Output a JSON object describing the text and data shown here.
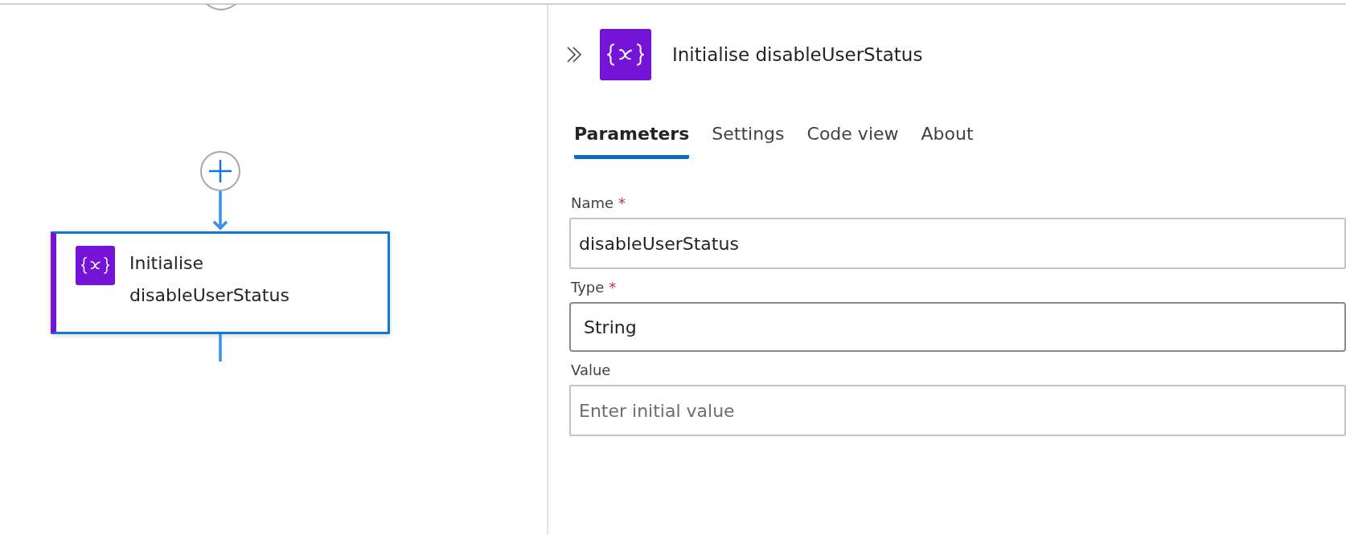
{
  "canvas": {
    "node": {
      "title": "Initialise disableUserStatus",
      "selected": true
    }
  },
  "panel": {
    "title": "Initialise disableUserStatus",
    "tabs": [
      {
        "label": "Parameters",
        "selected": true
      },
      {
        "label": "Settings",
        "selected": false
      },
      {
        "label": "Code view",
        "selected": false
      },
      {
        "label": "About",
        "selected": false
      }
    ],
    "fields": [
      {
        "kind": "text",
        "label": "Name",
        "required_mark": "*",
        "value": "disableUserStatus"
      },
      {
        "kind": "select",
        "label": "Type",
        "required_mark": "*",
        "value": "String"
      },
      {
        "kind": "text",
        "label": "Value",
        "placeholder": "Enter initial value"
      }
    ]
  }
}
